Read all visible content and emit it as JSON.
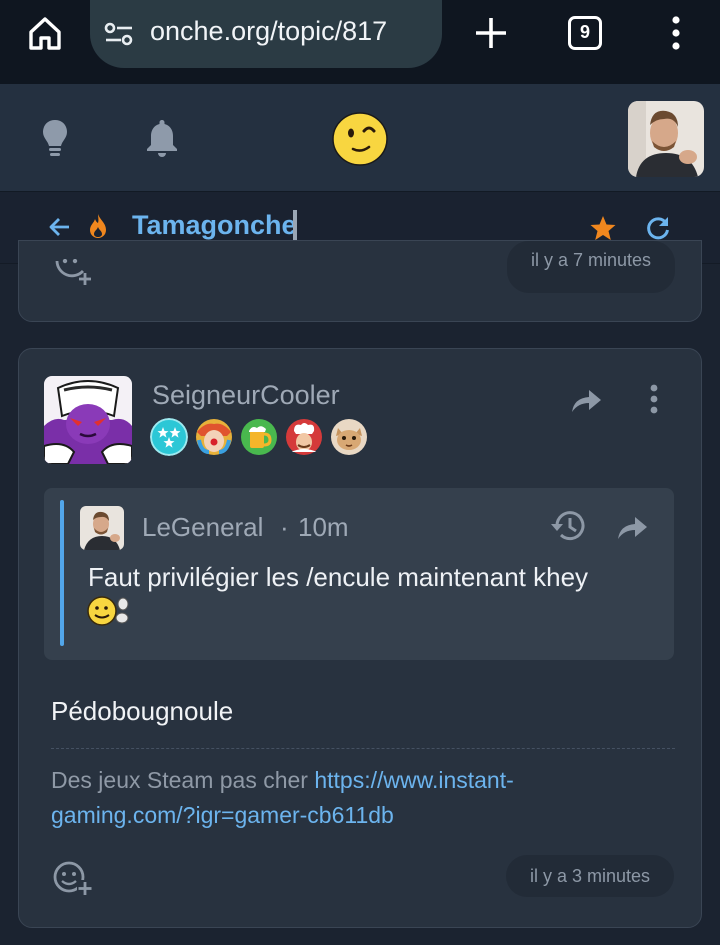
{
  "browser": {
    "url": "onche.org/topic/817",
    "tab_count": "9"
  },
  "topic": {
    "title": "Tamagonche"
  },
  "previous_post": {
    "time": "il y a 7 minutes"
  },
  "post": {
    "author": "SeigneurCooler",
    "badges": [
      "badge-stars",
      "badge-clown",
      "badge-beer",
      "badge-chef",
      "badge-cat"
    ],
    "quote": {
      "author": "LeGeneral",
      "separator": "·",
      "time": "10m",
      "text": "Faut privilégier les /encule maintenant khey"
    },
    "body": "Pédobougnoule",
    "signature": {
      "text": "Des jeux Steam pas cher",
      "link_part1": "https://www.instant-",
      "link_part2": "gaming.com/?igr=gamer-cb611db"
    },
    "time": "il y a 3 minutes"
  },
  "colors": {
    "accent": "#6cb4ee",
    "star": "#f0871e",
    "flame": "#f0871e",
    "card": "#28323f",
    "background": "#1b2330"
  },
  "icons": [
    "home-icon",
    "tune-icon",
    "plus-icon",
    "tabs-icon",
    "more-vert-icon",
    "lightbulb-icon",
    "bell-icon",
    "smiley-logo-icon",
    "back-arrow-icon",
    "flame-icon",
    "star-icon",
    "refresh-icon",
    "share-icon",
    "history-icon",
    "add-reaction-icon"
  ]
}
